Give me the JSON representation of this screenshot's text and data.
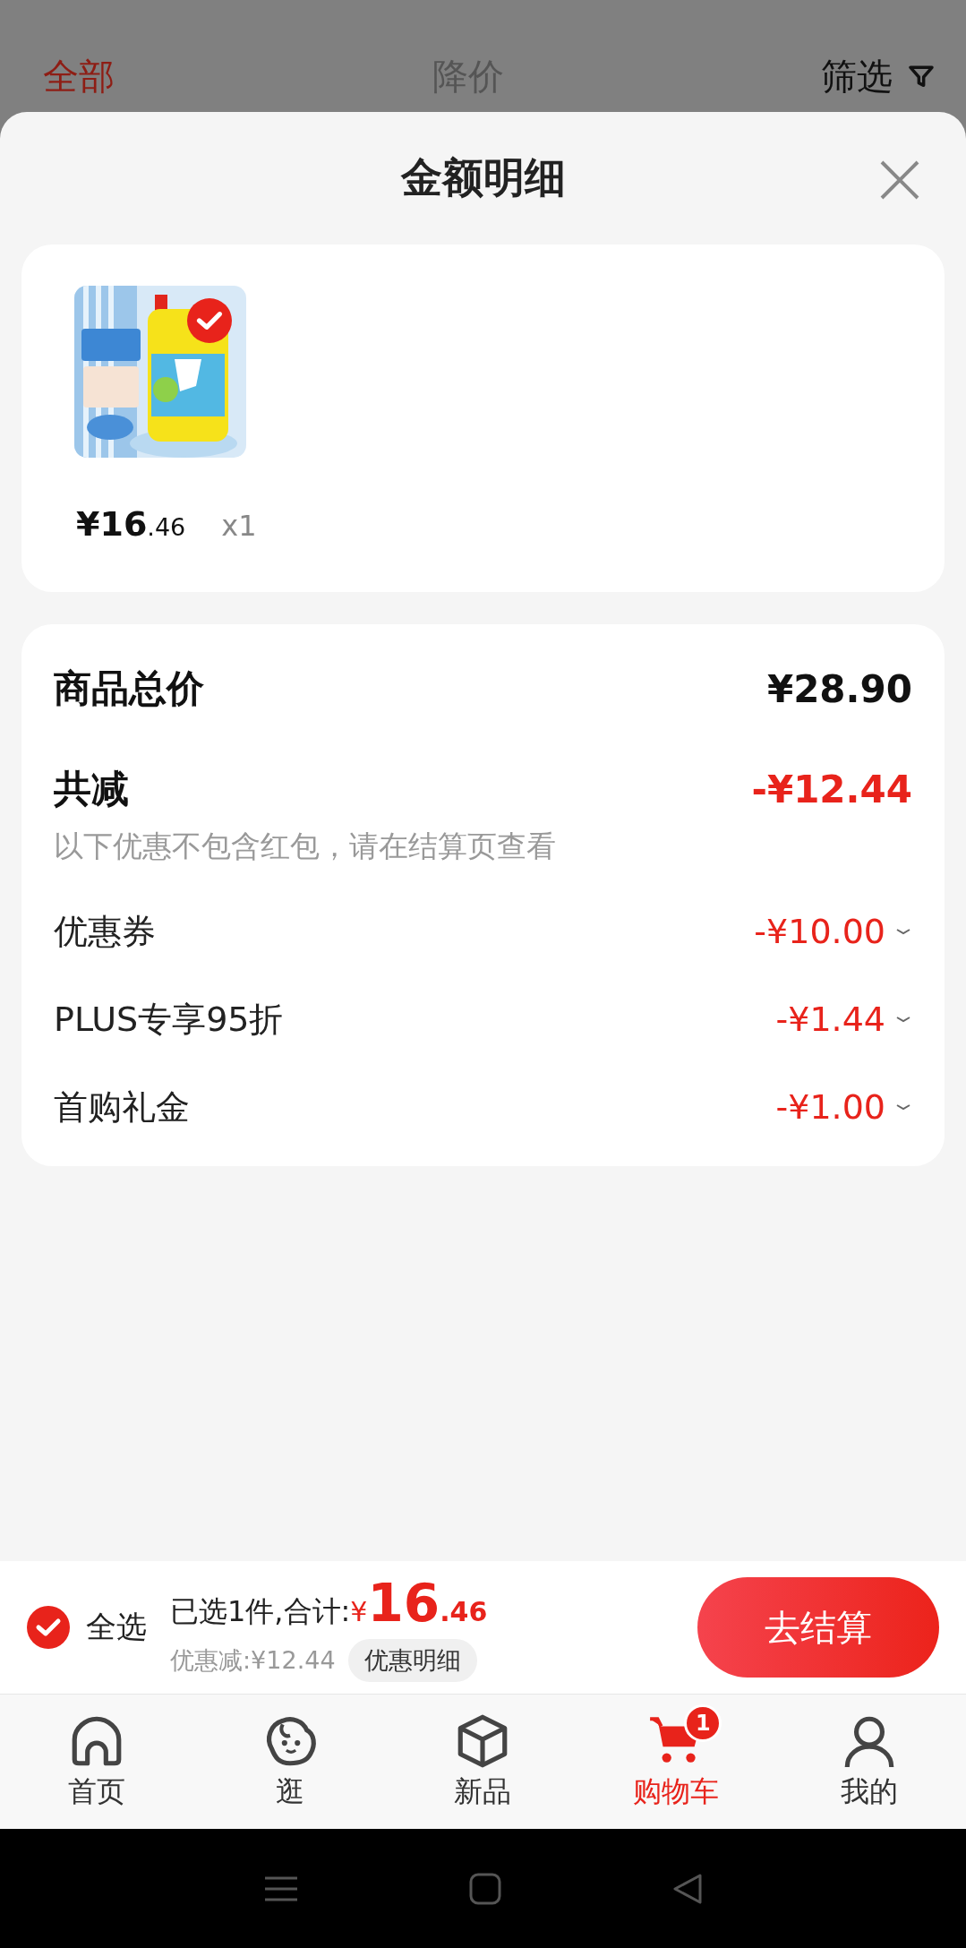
{
  "top_tabs": [
    {
      "label": "全部",
      "selected": true
    },
    {
      "label": "降价",
      "selected": false
    }
  ],
  "filter": {
    "label": "筛选"
  },
  "sheet": {
    "title": "金额明细"
  },
  "item": {
    "kind": "picture",
    "selected": true,
    "price_main": "¥16",
    "price_decimal": ".46",
    "quantity": "x1"
  },
  "summary": {
    "total_label": "商品总价",
    "total_value": "¥28.90",
    "discount_label": "共减",
    "discount_value": "-¥12.44",
    "note": "以下优惠不包含红包，请在结算页查看",
    "discounts": [
      {
        "label": "优惠券",
        "value": "-¥10.00",
        "expanded": false
      },
      {
        "label": "PLUS专享95折",
        "value": "-¥1.44",
        "expanded": false
      },
      {
        "label": "首购礼金",
        "value": "-¥1.00",
        "expanded": false
      }
    ]
  },
  "checkout": {
    "select_all": {
      "label": "全选",
      "checked": true
    },
    "selected_count": "已选1件,合计:",
    "total_currency": "¥",
    "total_main": "16",
    "total_decimal": ".46",
    "saving": "优惠减:¥12.44",
    "detail_button": "优惠明细",
    "submit": "去结算"
  },
  "tabbar": [
    {
      "kind": "home",
      "label": "首页",
      "selected": false
    },
    {
      "kind": "browse",
      "label": "逛",
      "selected": false
    },
    {
      "kind": "new",
      "label": "新品",
      "selected": false
    },
    {
      "kind": "cart",
      "label": "购物车",
      "selected": true,
      "badge": "1"
    },
    {
      "kind": "me",
      "label": "我的",
      "selected": false
    }
  ]
}
